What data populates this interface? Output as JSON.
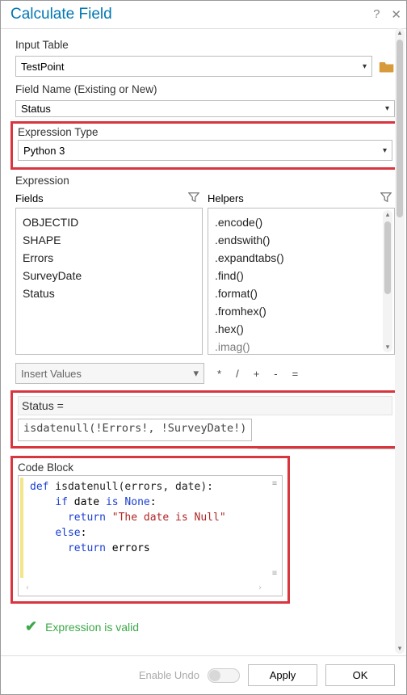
{
  "title": "Calculate Field",
  "labels": {
    "input_table": "Input Table",
    "field_name": "Field Name (Existing or New)",
    "expression_type": "Expression Type",
    "expression": "Expression",
    "fields": "Fields",
    "helpers": "Helpers",
    "insert_values": "Insert Values",
    "code_block": "Code Block",
    "enable_undo": "Enable Undo",
    "apply": "Apply",
    "ok": "OK"
  },
  "values": {
    "input_table": "TestPoint",
    "field_name": "Status",
    "expression_type": "Python 3",
    "status_eq": "Status =",
    "expression_text": "isdatenull(!Errors!, !SurveyDate!)",
    "valid_msg": "Expression is valid"
  },
  "fields_list": [
    "OBJECTID",
    "SHAPE",
    "Errors",
    "SurveyDate",
    "Status"
  ],
  "helpers_list": [
    ".encode()",
    ".endswith()",
    ".expandtabs()",
    ".find()",
    ".format()",
    ".fromhex()",
    ".hex()",
    ".imag()"
  ],
  "operators": [
    "*",
    "/",
    "+",
    "-",
    "="
  ],
  "code": {
    "l1_kw": "def",
    "l1_rest": " isdatenull(errors, date):",
    "l2_kw": "if",
    "l2_mid": " date ",
    "l2_is": "is",
    "l2_sp": " ",
    "l2_none": "None",
    "l2_colon": ":",
    "l3_kw": "return",
    "l3_sp": " ",
    "l3_str": "\"The date is Null\"",
    "l4_kw": "else",
    "l4_colon": ":",
    "l5_kw": "return",
    "l5_rest": " errors"
  }
}
